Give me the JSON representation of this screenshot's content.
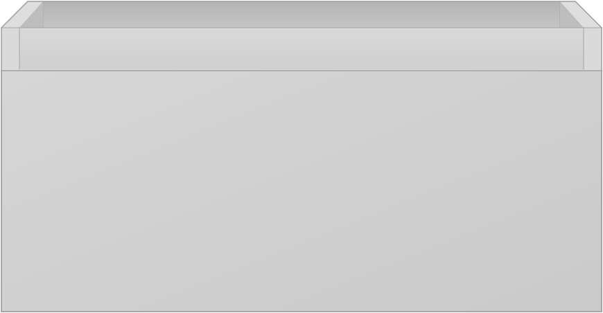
{
  "image": {
    "subject": "drawer-unit",
    "view": "front",
    "colors": {
      "background": "#ffffff",
      "front_panel": "#cecece",
      "front_panel_light": "#d6d6d6",
      "rim_face": "#d3d3d3",
      "rim_top": "#c8c8c8",
      "inner_back": "#c5c5c5",
      "inner_shadow": "#b4b4b4",
      "side_post": "#dadada",
      "edge_line": "#9e9e9e",
      "highlight": "#e6e6e6"
    }
  }
}
